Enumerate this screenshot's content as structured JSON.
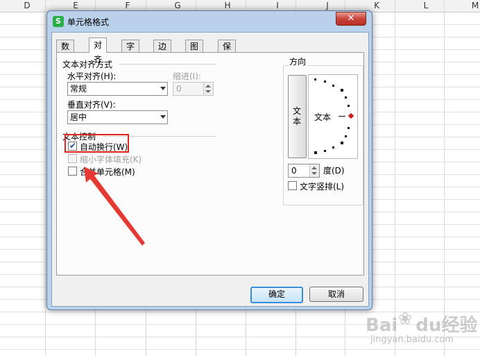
{
  "sheet": {
    "columns": [
      "D",
      "E",
      "F",
      "G",
      "H",
      "I",
      "J",
      "K",
      "L",
      "M"
    ]
  },
  "dialog": {
    "title": "单元格格式",
    "close_symbol": "✕",
    "tabs": [
      "数字",
      "对齐",
      "字体",
      "边框",
      "图案",
      "保护"
    ],
    "alignment": {
      "group_title": "文本对齐方式",
      "horizontal_label": "水平对齐(H):",
      "horizontal_value": "常规",
      "indent_label": "缩进(I):",
      "indent_value": "0",
      "vertical_label": "垂直对齐(V):",
      "vertical_value": "居中"
    },
    "text_control": {
      "group_title": "文本控制",
      "wrap_text": "自动换行(W)",
      "wrap_text_checked": true,
      "shrink_to_fit": "缩小字体填充(K)",
      "merge_cells": "合并单元格(M)"
    },
    "orientation": {
      "group_title": "方向",
      "vertical_button_text": "文本",
      "dial_text": "文本",
      "degree_value": "0",
      "degree_label": "度(D)",
      "vertical_layout": "文字竖排(L)"
    },
    "buttons": {
      "ok": "确定",
      "cancel": "取消"
    }
  },
  "watermark": {
    "brand": "Bai",
    "brand2": "du",
    "suffix": "经验",
    "url": "jingyan.baidu.com"
  }
}
